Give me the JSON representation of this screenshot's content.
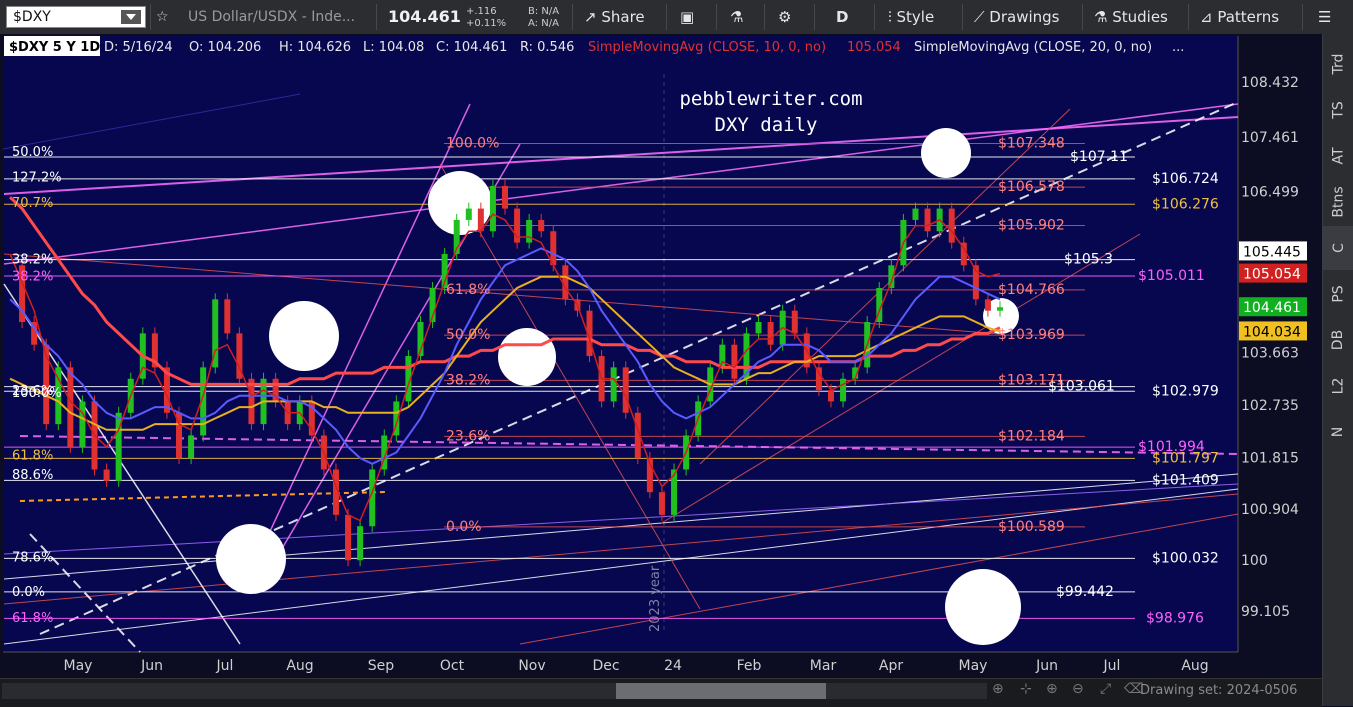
{
  "toolbar": {
    "symbol": "$DXY",
    "description": "US Dollar/USDX - Inde...",
    "last_price": "104.461",
    "change_abs": "+.116",
    "change_pct": "+0.11%",
    "bid": "B: N/A",
    "ask": "A: N/A",
    "share_label": "Share",
    "period_label": "D",
    "style_label": "Style",
    "drawings_label": "Drawings",
    "studies_label": "Studies",
    "patterns_label": "Patterns"
  },
  "infobar": {
    "chart_label": "$DXY 5 Y 1D",
    "date": "D: 5/16/24",
    "open": "O: 104.206",
    "high": "H: 104.626",
    "low": "L: 104.08",
    "close": "C: 104.461",
    "range": "R: 0.546",
    "sma10_label": "SimpleMovingAvg (CLOSE, 10, 0, no)",
    "sma10_value": "105.054",
    "sma20_label": "SimpleMovingAvg (CLOSE, 20, 0, no)",
    "more": "..."
  },
  "watermark": {
    "line1": "pebblewriter.com",
    "line2": "DXY daily",
    "year_label": "2023 year"
  },
  "right_tabs": [
    "Trd",
    "TS",
    "AT",
    "Btns",
    "C",
    "PS",
    "DB",
    "L2",
    "N"
  ],
  "active_tab": "C",
  "bottom": {
    "drawing_set": "Drawing set: 2024-0506"
  },
  "chart_data": {
    "type": "line",
    "x_ticks": [
      "May",
      "Jun",
      "Jul",
      "Aug",
      "Sep",
      "Oct",
      "Nov",
      "Dec",
      "24",
      "Feb",
      "Mar",
      "Apr",
      "May",
      "Jun",
      "Jul",
      "Aug"
    ],
    "y_ticks": [
      108.432,
      107.461,
      106.499,
      105.445,
      104.461,
      103.663,
      102.735,
      101.815,
      100.904,
      100,
      99.105
    ],
    "y_tick_labels": [
      "108.432",
      "107.461",
      "106.499",
      "",
      "",
      "103.663",
      "102.735",
      "101.815",
      "100.904",
      "100",
      "99.105"
    ],
    "ylim": [
      98.7,
      108.9
    ],
    "grid": false,
    "price_tags": [
      {
        "value": 105.445,
        "label": "105.445",
        "bg": "#ffffff",
        "fg": "#000000"
      },
      {
        "value": 105.054,
        "label": "105.054",
        "bg": "#d02020",
        "fg": "#ffffff"
      },
      {
        "value": 104.461,
        "label": "104.461",
        "bg": "#10b020",
        "fg": "#ffffff"
      },
      {
        "value": 104.034,
        "label": "104.034",
        "bg": "#f0c020",
        "fg": "#000000"
      }
    ],
    "horizontal_levels": [
      {
        "value": 107.11,
        "label": "$107.11",
        "color": "#ffffff"
      },
      {
        "value": 106.724,
        "label": "$106.724",
        "color": "#ffffff"
      },
      {
        "value": 106.276,
        "label": "$106.276",
        "color": "#f0c040"
      },
      {
        "value": 105.3,
        "label": "$105.3",
        "color": "#ffffff"
      },
      {
        "value": 105.011,
        "label": "$105.011",
        "color": "#ff60ff"
      },
      {
        "value": 103.061,
        "label": "$103.061",
        "color": "#ffffff"
      },
      {
        "value": 102.979,
        "label": "$102.979",
        "color": "#ffffff"
      },
      {
        "value": 101.994,
        "label": "$101.994",
        "color": "#ff60ff"
      },
      {
        "value": 101.797,
        "label": "$101.797",
        "color": "#f0c040"
      },
      {
        "value": 101.409,
        "label": "$101.409",
        "color": "#ffffff"
      },
      {
        "value": 100.032,
        "label": "$100.032",
        "color": "#ffffff"
      },
      {
        "value": 99.442,
        "label": "$99.442",
        "color": "#ffffff"
      },
      {
        "value": 98.976,
        "label": "$98.976",
        "color": "#ff60ff"
      }
    ],
    "fib_right": [
      {
        "value": 107.348,
        "label": "$107.348"
      },
      {
        "value": 106.578,
        "label": "$106.578"
      },
      {
        "value": 105.902,
        "label": "$105.902"
      },
      {
        "value": 104.766,
        "label": "$104.766"
      },
      {
        "value": 103.969,
        "label": "$103.969"
      },
      {
        "value": 103.171,
        "label": "$103.171"
      },
      {
        "value": 102.184,
        "label": "$102.184"
      },
      {
        "value": 100.589,
        "label": "$100.589"
      }
    ],
    "fib_mid": [
      {
        "value": 107.348,
        "label": "100.0%"
      },
      {
        "value": 104.766,
        "label": "61.8%"
      },
      {
        "value": 103.969,
        "label": "50.0%"
      },
      {
        "value": 103.171,
        "label": "38.2%"
      },
      {
        "value": 102.184,
        "label": "23.6%"
      },
      {
        "value": 100.589,
        "label": "0.0%"
      }
    ],
    "fib_left": [
      {
        "value": 107.2,
        "label": "50.0%",
        "color": "#ffffff"
      },
      {
        "value": 106.75,
        "label": "127.2%",
        "color": "#ffffff"
      },
      {
        "value": 106.3,
        "label": "70.7%",
        "color": "#f0c040"
      },
      {
        "value": 105.3,
        "label": "38.2%",
        "color": "#ffffff"
      },
      {
        "value": 105.0,
        "label": "38.2%",
        "color": "#ff60ff"
      },
      {
        "value": 102.98,
        "label": "23.6%",
        "color": "#ffffff"
      },
      {
        "value": 102.95,
        "label": "100.0%",
        "color": "#ffffff"
      },
      {
        "value": 101.85,
        "label": "61.8%",
        "color": "#f0c040"
      },
      {
        "value": 101.5,
        "label": "88.6%",
        "color": "#ffffff"
      },
      {
        "value": 100.05,
        "label": "78.6%",
        "color": "#ffffff"
      },
      {
        "value": 99.44,
        "label": "0.0%",
        "color": "#ffffff"
      },
      {
        "value": 98.98,
        "label": "61.8%",
        "color": "#ff60ff"
      }
    ],
    "price": [
      105.2,
      104.2,
      103.8,
      102.4,
      103.4,
      102.0,
      102.8,
      101.6,
      101.4,
      102.6,
      103.2,
      104.0,
      103.4,
      102.6,
      101.8,
      102.2,
      103.4,
      104.6,
      104.0,
      103.2,
      102.4,
      103.2,
      102.8,
      102.4,
      102.8,
      102.2,
      101.6,
      100.8,
      100.0,
      100.6,
      101.6,
      102.2,
      102.8,
      103.6,
      104.2,
      104.8,
      105.4,
      106.0,
      106.2,
      105.8,
      106.6,
      106.2,
      105.6,
      106.0,
      105.8,
      105.2,
      104.6,
      104.4,
      103.6,
      102.8,
      103.4,
      102.6,
      101.8,
      101.2,
      100.8,
      101.6,
      102.2,
      102.8,
      103.4,
      103.8,
      103.2,
      104.0,
      104.2,
      103.8,
      104.4,
      104.0,
      103.4,
      103.0,
      102.8,
      103.2,
      103.4,
      104.2,
      104.8,
      105.2,
      106.0,
      106.2,
      105.8,
      106.2,
      105.6,
      105.2,
      104.6,
      104.4,
      104.461
    ],
    "sma10": [
      105.4,
      104.9,
      104.4,
      103.6,
      103.2,
      102.8,
      102.6,
      102.2,
      102.0,
      102.3,
      102.9,
      103.4,
      103.3,
      102.9,
      102.4,
      102.3,
      102.9,
      103.7,
      103.8,
      103.4,
      102.9,
      103.0,
      102.9,
      102.6,
      102.6,
      102.3,
      101.9,
      101.3,
      100.8,
      100.7,
      101.2,
      101.8,
      102.4,
      103.1,
      103.7,
      104.3,
      104.9,
      105.5,
      105.8,
      105.8,
      106.1,
      106.0,
      105.7,
      105.7,
      105.6,
      105.2,
      104.8,
      104.5,
      103.9,
      103.2,
      103.2,
      102.9,
      102.3,
      101.7,
      101.3,
      101.5,
      101.9,
      102.5,
      103.0,
      103.5,
      103.4,
      103.7,
      103.9,
      103.9,
      104.1,
      104.0,
      103.7,
      103.3,
      103.0,
      103.1,
      103.2,
      103.8,
      104.4,
      104.9,
      105.6,
      105.9,
      105.9,
      106.0,
      105.8,
      105.5,
      105.1,
      105.0,
      105.054
    ],
    "sma50": [
      104.6,
      104.4,
      104.1,
      103.8,
      103.6,
      103.3,
      103.1,
      102.8,
      102.6,
      102.5,
      102.5,
      102.6,
      102.7,
      102.7,
      102.6,
      102.5,
      102.5,
      102.6,
      102.8,
      102.9,
      102.9,
      102.9,
      102.9,
      102.8,
      102.8,
      102.7,
      102.5,
      102.3,
      102.0,
      101.8,
      101.7,
      101.8,
      101.9,
      102.2,
      102.5,
      102.9,
      103.3,
      103.8,
      104.2,
      104.6,
      104.9,
      105.2,
      105.3,
      105.4,
      105.5,
      105.4,
      105.3,
      105.1,
      104.8,
      104.4,
      104.1,
      103.8,
      103.5,
      103.1,
      102.8,
      102.6,
      102.5,
      102.6,
      102.7,
      102.9,
      103.1,
      103.3,
      103.5,
      103.6,
      103.8,
      103.8,
      103.8,
      103.7,
      103.5,
      103.5,
      103.5,
      103.6,
      103.8,
      104.0,
      104.3,
      104.6,
      104.8,
      105.0,
      105.0,
      104.9,
      104.8,
      104.7,
      104.6
    ],
    "sma100": [
      103.2,
      103.1,
      103.0,
      102.9,
      102.8,
      102.6,
      102.5,
      102.4,
      102.3,
      102.3,
      102.3,
      102.3,
      102.4,
      102.4,
      102.4,
      102.4,
      102.4,
      102.5,
      102.6,
      102.7,
      102.7,
      102.8,
      102.8,
      102.8,
      102.8,
      102.8,
      102.7,
      102.7,
      102.6,
      102.6,
      102.6,
      102.6,
      102.6,
      102.7,
      102.9,
      103.1,
      103.3,
      103.6,
      103.9,
      104.2,
      104.4,
      104.6,
      104.8,
      104.9,
      105.0,
      105.0,
      105.0,
      104.9,
      104.8,
      104.6,
      104.4,
      104.2,
      104.0,
      103.8,
      103.6,
      103.4,
      103.3,
      103.2,
      103.1,
      103.1,
      103.1,
      103.2,
      103.3,
      103.3,
      103.4,
      103.5,
      103.5,
      103.6,
      103.6,
      103.6,
      103.6,
      103.7,
      103.8,
      103.9,
      104.0,
      104.1,
      104.2,
      104.3,
      104.3,
      104.3,
      104.2,
      104.1,
      104.034
    ],
    "sma200": [
      106.4,
      106.2,
      105.9,
      105.6,
      105.3,
      105.0,
      104.7,
      104.5,
      104.2,
      104.0,
      103.8,
      103.6,
      103.5,
      103.3,
      103.2,
      103.1,
      103.1,
      103.1,
      103.1,
      103.1,
      103.1,
      103.1,
      103.1,
      103.1,
      103.2,
      103.2,
      103.2,
      103.3,
      103.3,
      103.3,
      103.3,
      103.4,
      103.4,
      103.4,
      103.5,
      103.5,
      103.5,
      103.6,
      103.6,
      103.7,
      103.7,
      103.8,
      103.8,
      103.8,
      103.8,
      103.9,
      103.9,
      103.9,
      103.9,
      103.8,
      103.8,
      103.8,
      103.7,
      103.7,
      103.6,
      103.6,
      103.5,
      103.5,
      103.5,
      103.4,
      103.4,
      103.4,
      103.4,
      103.5,
      103.5,
      103.5,
      103.5,
      103.5,
      103.5,
      103.5,
      103.5,
      103.6,
      103.6,
      103.6,
      103.7,
      103.7,
      103.8,
      103.8,
      103.9,
      103.9,
      104.0,
      104.0,
      104.1
    ]
  }
}
